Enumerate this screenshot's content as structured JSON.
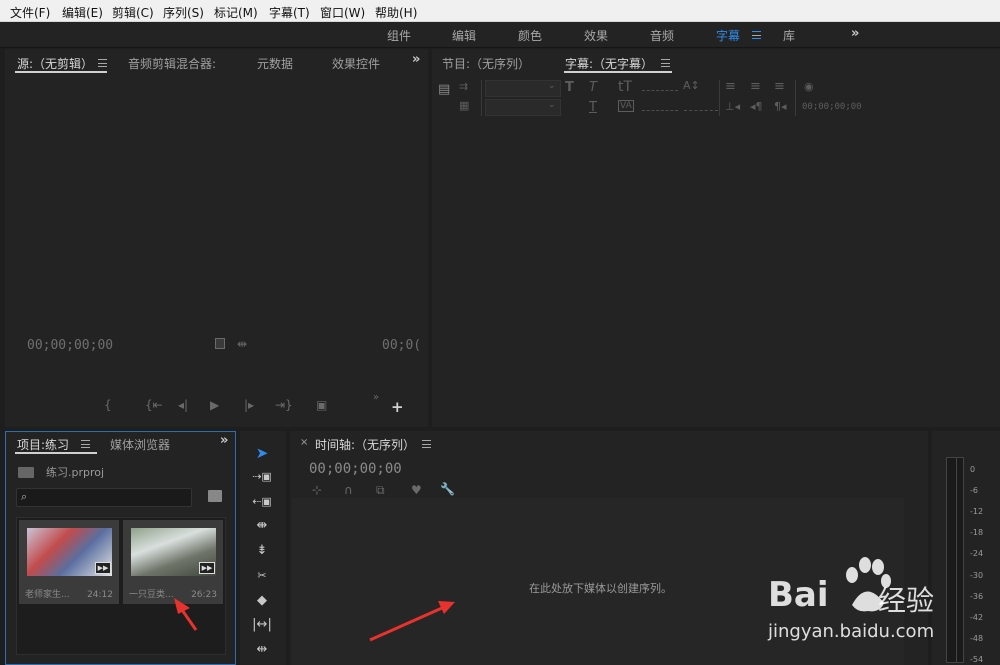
{
  "menubar": {
    "items": [
      "文件(F)",
      "编辑(E)",
      "剪辑(C)",
      "序列(S)",
      "标记(M)",
      "字幕(T)",
      "窗口(W)",
      "帮助(H)"
    ]
  },
  "workspace": {
    "tabs": [
      "组件",
      "编辑",
      "颜色",
      "效果",
      "音频",
      "字幕",
      "库"
    ],
    "active": "字幕"
  },
  "source_panel": {
    "tabs": [
      "源:（无剪辑）",
      "音频剪辑混合器:",
      "元数据",
      "效果控件"
    ],
    "timecode_left": "00;00;00;00",
    "timecode_right": "00;0("
  },
  "program_panel": {
    "tabs": [
      "节目:（无序列）",
      "字幕:（无字幕）"
    ],
    "timecode": "00;00;00;00"
  },
  "project_panel": {
    "tabs": [
      "项目:练习",
      "媒体浏览器"
    ],
    "project_file": "练习.prproj",
    "search": {
      "value": ""
    },
    "clips": [
      {
        "name": "老师家生...",
        "duration": "24:12"
      },
      {
        "name": "一只豆类...",
        "duration": "26:23"
      }
    ]
  },
  "timeline_panel": {
    "title": "时间轴:（无序列）",
    "timecode": "00;00;00;00",
    "drop_hint": "在此处放下媒体以创建序列。"
  },
  "audio_meter": {
    "labels": [
      "0",
      "-6",
      "-12",
      "-18",
      "-24",
      "-30",
      "-36",
      "-42",
      "-48",
      "-54"
    ]
  },
  "watermark": {
    "brand": "Bai",
    "brand_cn": "经验",
    "url": "jingyan.baidu.com"
  },
  "colors": {
    "accent": "#2d8ceb",
    "annotation_arrow": "#e8322d"
  }
}
